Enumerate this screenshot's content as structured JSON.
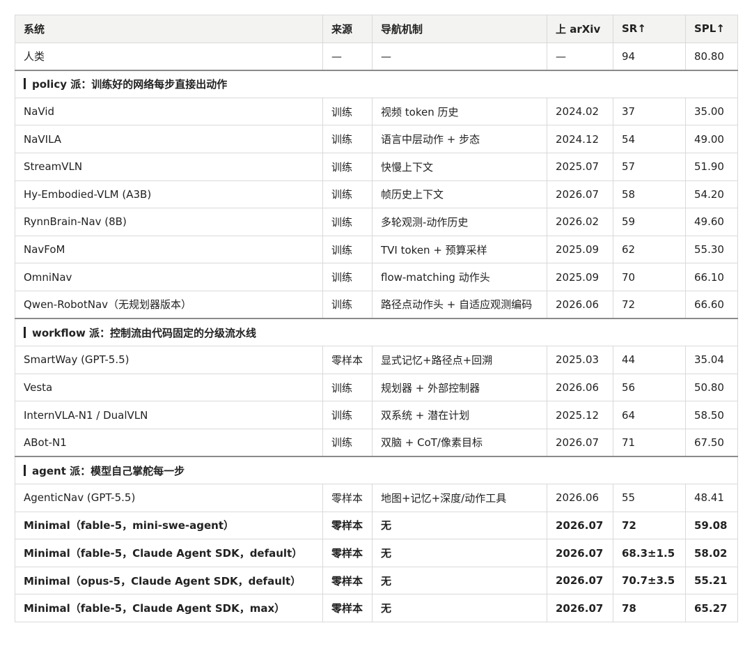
{
  "header": [
    "系统",
    "来源",
    "导航机制",
    "上 arXiv",
    "SR↑",
    "SPL↑"
  ],
  "groups": [
    {
      "title": "",
      "rows": [
        {
          "name": "人类",
          "source": "—",
          "mechanism": "—",
          "arxiv": "—",
          "sr": "94",
          "spl": "80.80",
          "bold": false
        }
      ]
    },
    {
      "title": "policy 派：训练好的网络每步直接出动作",
      "rows": [
        {
          "name": "NaVid",
          "source": "训练",
          "mechanism": "视频 token 历史",
          "arxiv": "2024.02",
          "sr": "37",
          "spl": "35.00",
          "bold": false
        },
        {
          "name": "NaVILA",
          "source": "训练",
          "mechanism": "语言中层动作 + 步态",
          "arxiv": "2024.12",
          "sr": "54",
          "spl": "49.00",
          "bold": false
        },
        {
          "name": "StreamVLN",
          "source": "训练",
          "mechanism": "快慢上下文",
          "arxiv": "2025.07",
          "sr": "57",
          "spl": "51.90",
          "bold": false
        },
        {
          "name": "Hy-Embodied-VLM (A3B)",
          "source": "训练",
          "mechanism": "帧历史上下文",
          "arxiv": "2026.07",
          "sr": "58",
          "spl": "54.20",
          "bold": false
        },
        {
          "name": "RynnBrain-Nav (8B)",
          "source": "训练",
          "mechanism": "多轮观测-动作历史",
          "arxiv": "2026.02",
          "sr": "59",
          "spl": "49.60",
          "bold": false
        },
        {
          "name": "NavFoM",
          "source": "训练",
          "mechanism": "TVI token + 预算采样",
          "arxiv": "2025.09",
          "sr": "62",
          "spl": "55.30",
          "bold": false
        },
        {
          "name": "OmniNav",
          "source": "训练",
          "mechanism": "flow-matching 动作头",
          "arxiv": "2025.09",
          "sr": "70",
          "spl": "66.10",
          "bold": false
        },
        {
          "name": "Qwen-RobotNav（无规划器版本）",
          "source": "训练",
          "mechanism": "路径点动作头 + 自适应观测编码",
          "arxiv": "2026.06",
          "sr": "72",
          "spl": "66.60",
          "bold": false
        }
      ]
    },
    {
      "title": "workflow 派：控制流由代码固定的分级流水线",
      "rows": [
        {
          "name": "SmartWay (GPT-5.5)",
          "source": "零样本",
          "mechanism": "显式记忆+路径点+回溯",
          "arxiv": "2025.03",
          "sr": "44",
          "spl": "35.04",
          "bold": false
        },
        {
          "name": "Vesta",
          "source": "训练",
          "mechanism": "规划器 + 外部控制器",
          "arxiv": "2026.06",
          "sr": "56",
          "spl": "50.80",
          "bold": false
        },
        {
          "name": "InternVLA-N1 / DualVLN",
          "source": "训练",
          "mechanism": "双系统 + 潜在计划",
          "arxiv": "2025.12",
          "sr": "64",
          "spl": "58.50",
          "bold": false
        },
        {
          "name": "ABot-N1",
          "source": "训练",
          "mechanism": "双脑 + CoT/像素目标",
          "arxiv": "2026.07",
          "sr": "71",
          "spl": "67.50",
          "bold": false
        }
      ]
    },
    {
      "title": "agent 派：模型自己掌舵每一步",
      "rows": [
        {
          "name": "AgenticNav (GPT-5.5)",
          "source": "零样本",
          "mechanism": "地图+记忆+深度/动作工具",
          "arxiv": "2026.06",
          "sr": "55",
          "spl": "48.41",
          "bold": false
        },
        {
          "name": "Minimal（fable-5，mini-swe-agent）",
          "source": "零样本",
          "mechanism": "无",
          "arxiv": "2026.07",
          "sr": "72",
          "spl": "59.08",
          "bold": true
        },
        {
          "name": "Minimal（fable-5，Claude Agent SDK，default）",
          "source": "零样本",
          "mechanism": "无",
          "arxiv": "2026.07",
          "sr": "68.3±1.5",
          "spl": "58.02",
          "bold": true
        },
        {
          "name": "Minimal（opus-5，Claude Agent SDK，default）",
          "source": "零样本",
          "mechanism": "无",
          "arxiv": "2026.07",
          "sr": "70.7±3.5",
          "spl": "55.21",
          "bold": true
        },
        {
          "name": "Minimal（fable-5，Claude Agent SDK，max）",
          "source": "零样本",
          "mechanism": "无",
          "arxiv": "2026.07",
          "sr": "78",
          "spl": "65.27",
          "bold": true
        }
      ]
    }
  ]
}
